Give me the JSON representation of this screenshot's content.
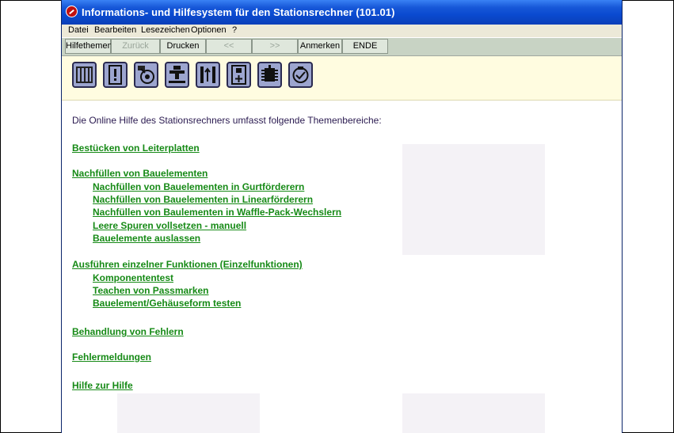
{
  "window": {
    "title": "Informations- und Hilfesystem für den Stationsrechner (101.01)"
  },
  "menu": [
    "Datei",
    "Bearbeiten",
    "Lesezeichen",
    "Optionen",
    "?"
  ],
  "toolbar": {
    "hilfethemen": "Hilfethemen",
    "zurueck": "Zurück",
    "drucken": "Drucken",
    "back": "<<",
    "forward": ">>",
    "anmerken": "Anmerken",
    "ende": "ENDE"
  },
  "icons": [
    "feeder-icon",
    "warning-icon",
    "tape-reel-icon",
    "nozzle-icon",
    "lift-icon",
    "component-add-icon",
    "chip-icon",
    "cycle-icon"
  ],
  "content": {
    "intro": "Die Online Hilfe des Stationsrechners umfasst folgende Themenbereiche:",
    "topics": {
      "t1": "Bestücken von Leiterplatten",
      "t2": "Nachfüllen von Bauelementen",
      "t2a": "Nachfüllen von Bauelementen in Gurtförderern",
      "t2b": "Nachfüllen von Bauelementen in Linearförderern",
      "t2c": "Nachfüllen von Baulementen in Waffle-Pack-Wechslern",
      "t2d": "Leere Spuren vollsetzen - manuell",
      "t2e": "Bauelemente auslassen",
      "t3": "Ausführen einzelner Funktionen (Einzelfunktionen)",
      "t3a": "Komponententest",
      "t3b": "Teachen von Passmarken",
      "t3c": "Bauelement/Gehäuseform testen",
      "t4": "Behandlung von Fehlern",
      "t5": "Fehlermeldungen",
      "t6": "Hilfe zur Hilfe"
    }
  },
  "colors": {
    "link": "#168a16",
    "title_bar": "#0a4ad0",
    "icon_bar": "#fffce0",
    "button_bar": "#c8d3c4"
  }
}
